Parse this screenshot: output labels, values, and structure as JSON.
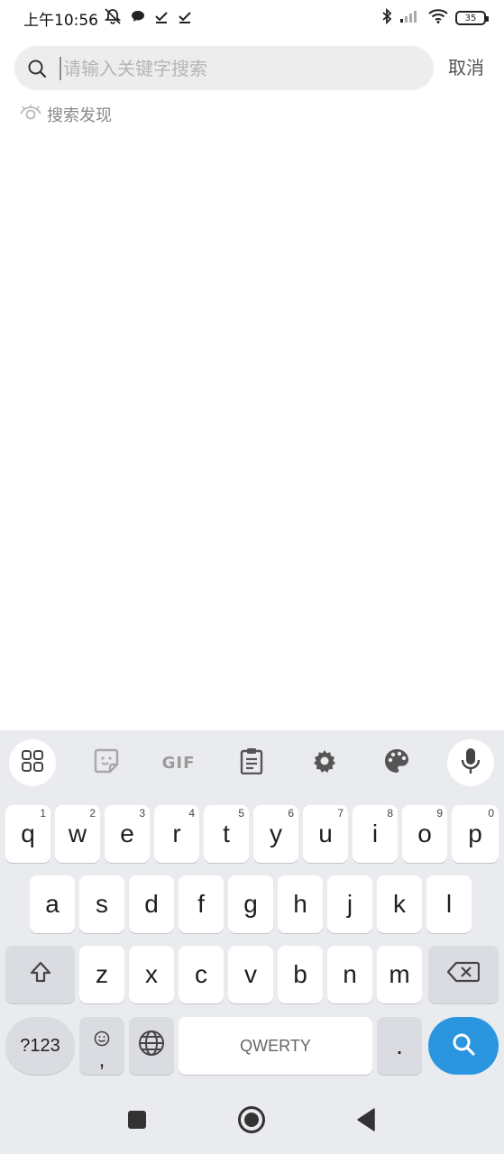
{
  "status_bar": {
    "time": "上午10:56",
    "battery": "35"
  },
  "search": {
    "placeholder": "请输入关键字搜索",
    "value": "",
    "cancel_label": "取消"
  },
  "discover": {
    "label": "搜索发现"
  },
  "keyboard": {
    "toolbar": {
      "gif_label": "GIF"
    },
    "row1": [
      {
        "key": "q",
        "hint": "1"
      },
      {
        "key": "w",
        "hint": "2"
      },
      {
        "key": "e",
        "hint": "3"
      },
      {
        "key": "r",
        "hint": "4"
      },
      {
        "key": "t",
        "hint": "5"
      },
      {
        "key": "y",
        "hint": "6"
      },
      {
        "key": "u",
        "hint": "7"
      },
      {
        "key": "i",
        "hint": "8"
      },
      {
        "key": "o",
        "hint": "9"
      },
      {
        "key": "p",
        "hint": "0"
      }
    ],
    "row2": [
      "a",
      "s",
      "d",
      "f",
      "g",
      "h",
      "j",
      "k",
      "l"
    ],
    "row3": [
      "z",
      "x",
      "c",
      "v",
      "b",
      "n",
      "m"
    ],
    "symbols_label": "?123",
    "comma_label": ",",
    "space_label": "QWERTY",
    "period_label": "."
  },
  "colors": {
    "accent": "#2a96e0",
    "search_bg": "#ededed",
    "keyboard_bg": "#e9ebee"
  }
}
